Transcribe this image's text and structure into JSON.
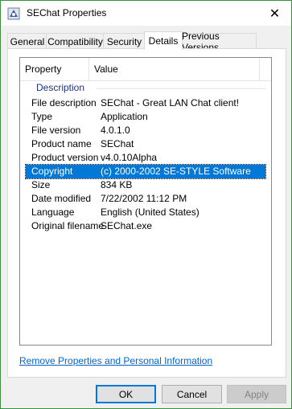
{
  "window": {
    "title": "SEChat Properties",
    "close_glyph": "✕"
  },
  "tabs": [
    {
      "label": "General"
    },
    {
      "label": "Compatibility"
    },
    {
      "label": "Security"
    },
    {
      "label": "Details",
      "active": true
    },
    {
      "label": "Previous Versions"
    }
  ],
  "details": {
    "columns": [
      "Property",
      "Value"
    ],
    "group": "Description",
    "rows": [
      {
        "property": "File description",
        "value": "SEChat - Great LAN Chat client!"
      },
      {
        "property": "Type",
        "value": "Application"
      },
      {
        "property": "File version",
        "value": "4.0.1.0"
      },
      {
        "property": "Product name",
        "value": "SEChat"
      },
      {
        "property": "Product version",
        "value": "v4.0.10Alpha"
      },
      {
        "property": "Copyright",
        "value": "(c) 2000-2002 SE-STYLE Software",
        "selected": true
      },
      {
        "property": "Size",
        "value": "834 KB"
      },
      {
        "property": "Date modified",
        "value": "7/22/2002 11:12 PM"
      },
      {
        "property": "Language",
        "value": "English (United States)"
      },
      {
        "property": "Original filename",
        "value": "SEChat.exe"
      }
    ]
  },
  "link": "Remove Properties and Personal Information",
  "buttons": {
    "ok": "OK",
    "cancel": "Cancel",
    "apply": "Apply"
  },
  "colors": {
    "selection": "#0078d7",
    "link": "#0066cc",
    "group": "#1e3287"
  },
  "icons": {
    "app": "chat-app-icon",
    "close": "close-icon"
  }
}
